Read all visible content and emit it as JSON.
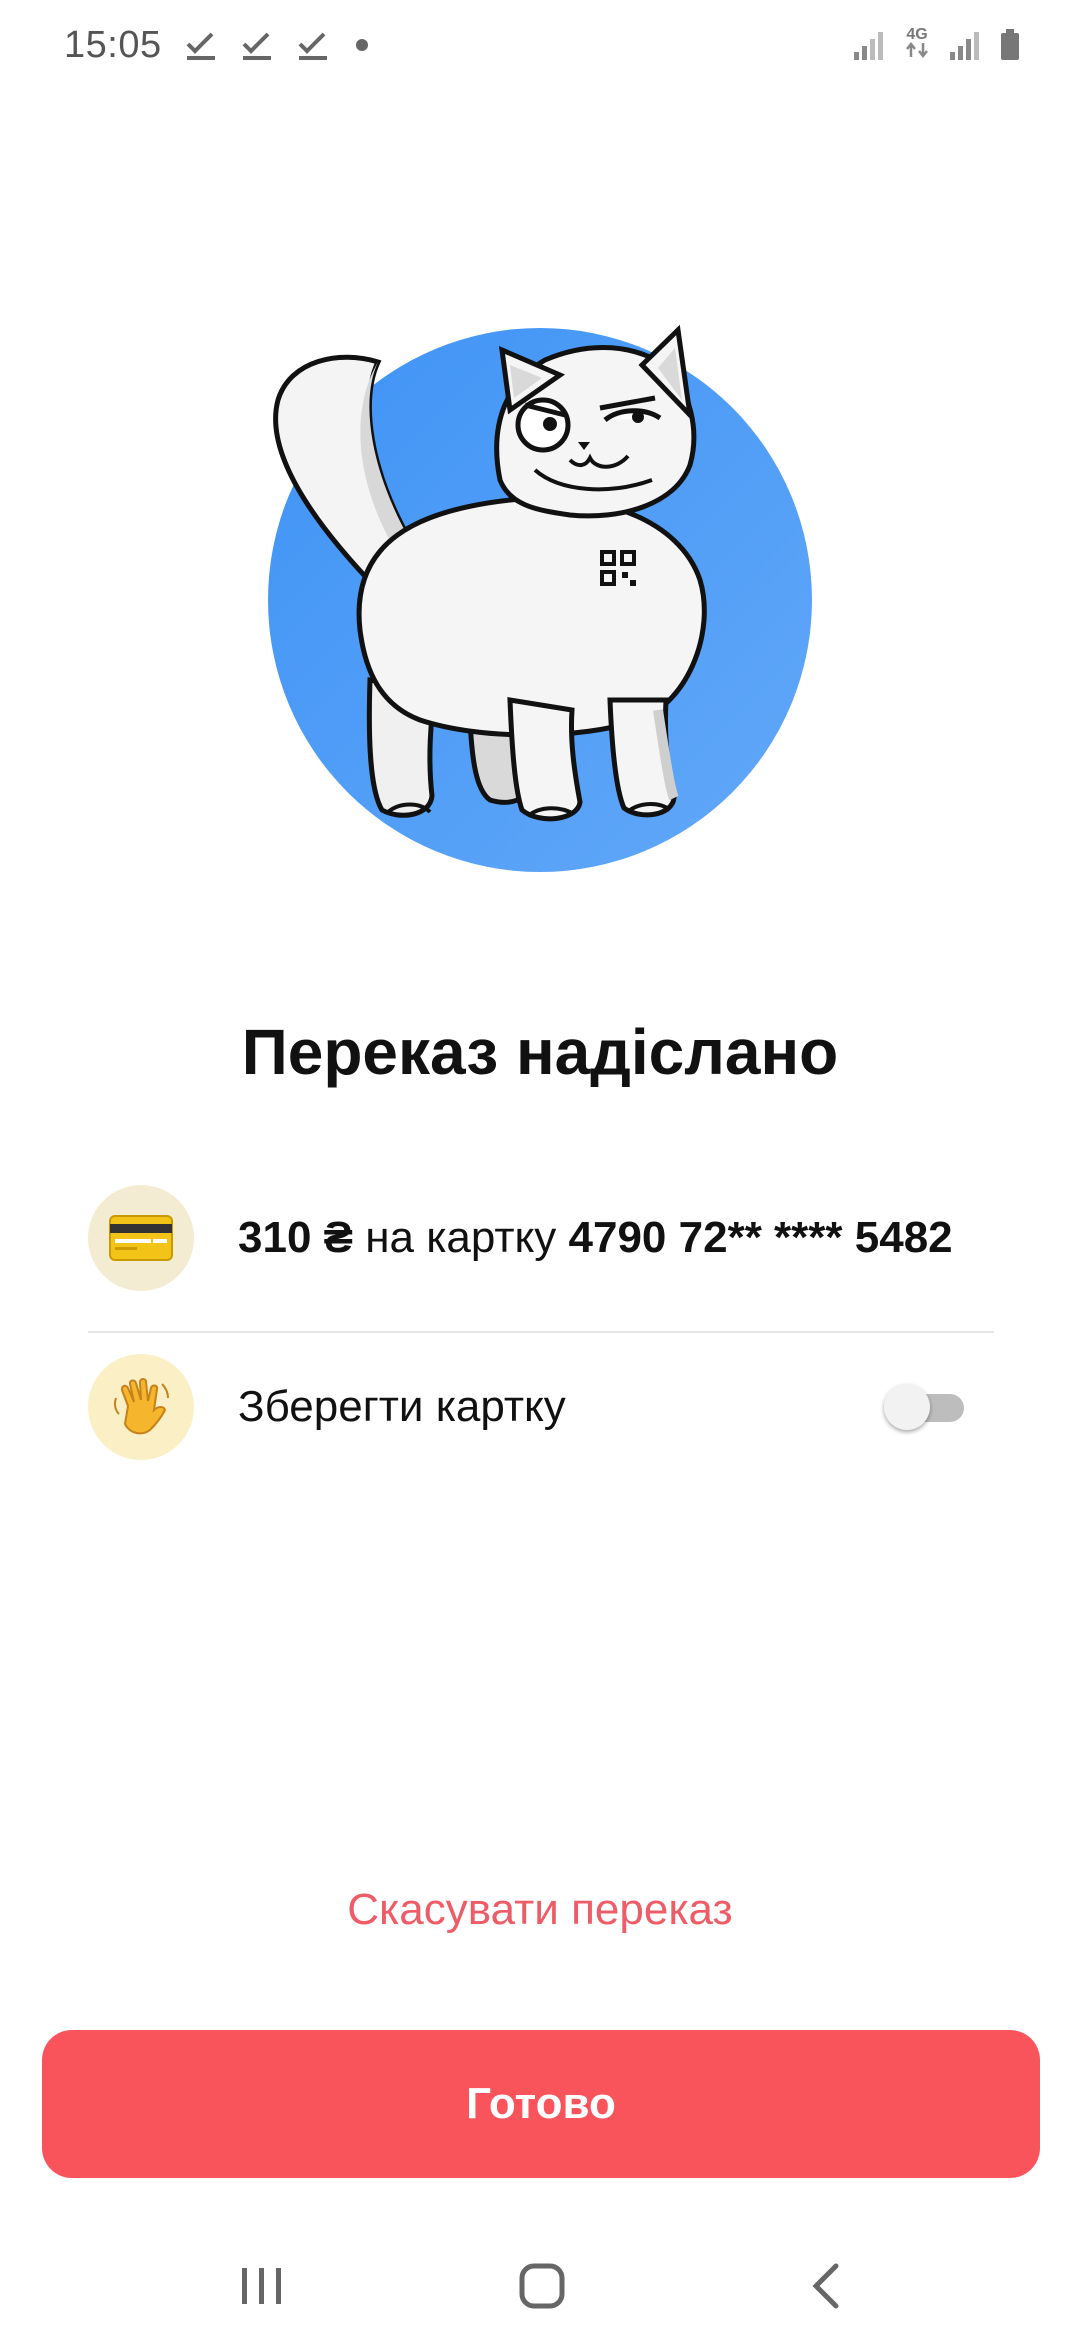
{
  "status_bar": {
    "time": "15:05",
    "network_label": "4G"
  },
  "illustration": {
    "description_icon": "cat-illustration",
    "circle_color": "#4d9af7"
  },
  "title": "Переказ надіслано",
  "transfer": {
    "amount": "310 ₴",
    "middle": " на картку ",
    "card_number": "4790 72** **** 5482",
    "icon": "credit-card-icon"
  },
  "save_card": {
    "label": "Зберегти картку",
    "icon": "waving-hand-icon",
    "enabled": false
  },
  "cancel_label": "Скасувати переказ",
  "done_label": "Готово",
  "colors": {
    "accent": "#f9535b",
    "cancel_text": "#ee5c68"
  }
}
